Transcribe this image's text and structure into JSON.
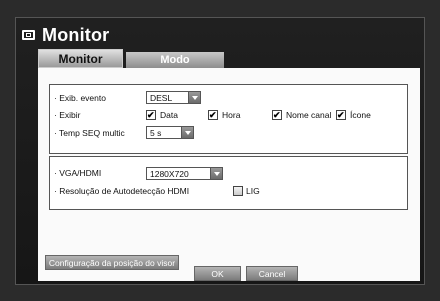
{
  "window": {
    "title": "Monitor"
  },
  "tabs": [
    {
      "label": "Monitor",
      "active": true
    },
    {
      "label": "Modo",
      "active": false
    }
  ],
  "group1": {
    "event_label": "· Exib. evento",
    "event_value": "DESL",
    "show_label": "· Exibir",
    "show_options": [
      {
        "label": "Data",
        "checked": true
      },
      {
        "label": "Hora",
        "checked": true
      },
      {
        "label": "Nome canal",
        "checked": true
      },
      {
        "label": "Ícone",
        "checked": true
      }
    ],
    "seq_label": "· Temp SEQ multic",
    "seq_value": "5 s"
  },
  "group2": {
    "vga_label": "· VGA/HDMI",
    "vga_value": "1280X720",
    "hdmi_label": "· Resolução de Autodetecção HDMI",
    "hdmi_option": {
      "label": "LIG",
      "checked": false
    }
  },
  "buttons": {
    "config": "Configuração da posição do visor",
    "ok": "OK",
    "cancel": "Cancel"
  },
  "icons": {
    "title": "monitor-icon",
    "dropdown": "chevron-down-icon",
    "check": "checkmark-icon"
  },
  "colors": {
    "background": "#2b2b2b",
    "panel": "#fafafa",
    "button": "#9a9a9a"
  }
}
